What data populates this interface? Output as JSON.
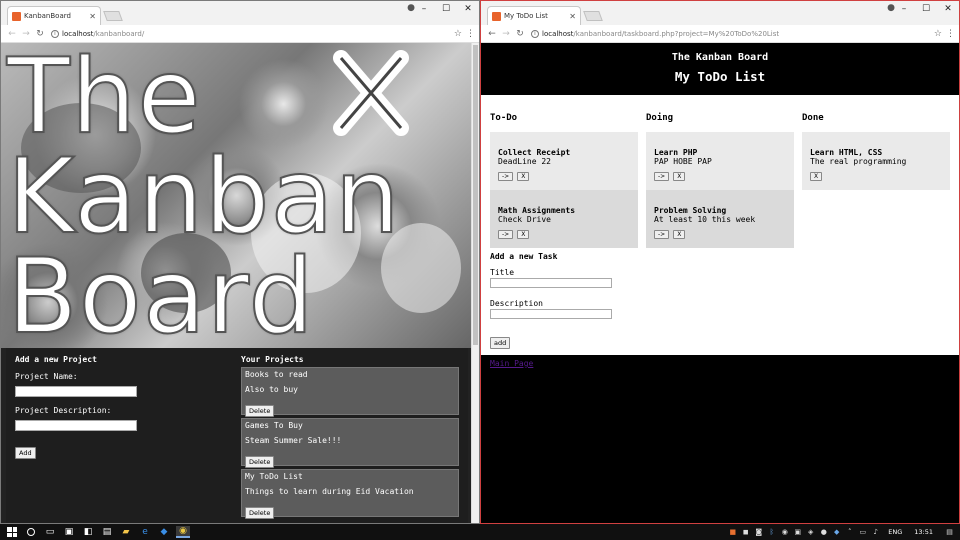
{
  "left_window": {
    "tab_title": "KanbanBoard",
    "url_host": "localhost",
    "url_path": "/kanbanboard/",
    "hero_title_line1": "The",
    "hero_title_line2": "Kanban",
    "hero_title_line3": "Board",
    "add_project": {
      "heading": "Add a new Project",
      "name_label": "Project Name:",
      "desc_label": "Project Description:",
      "add_button": "Add"
    },
    "your_projects": {
      "heading": "Your Projects",
      "items": [
        {
          "title": "Books to read",
          "description": "Also to buy",
          "delete": "Delete"
        },
        {
          "title": "Games To Buy",
          "description": "Steam Summer Sale!!!",
          "delete": "Delete"
        },
        {
          "title": "My ToDo List",
          "description": "Things to learn during Eid Vacation",
          "delete": "Delete"
        }
      ]
    }
  },
  "right_window": {
    "tab_title": "My ToDo List",
    "url_host": "localhost",
    "url_path": "/kanbanboard/taskboard.php?project=My%20ToDo%20List",
    "header_title": "The Kanban Board",
    "header_subtitle": "My ToDo List",
    "columns": [
      {
        "title": "To-Do",
        "tasks": [
          {
            "title": "Collect Receipt",
            "description": "DeadLine 22",
            "move": "->",
            "remove": "X"
          },
          {
            "title": "Math Assignments",
            "description": "Check Drive",
            "move": "->",
            "remove": "X"
          }
        ]
      },
      {
        "title": "Doing",
        "tasks": [
          {
            "title": "Learn PHP",
            "description": "PAP HOBE PAP",
            "move": "->",
            "remove": "X"
          },
          {
            "title": "Problem Solving",
            "description": "At least 10 this week",
            "move": "->",
            "remove": "X"
          }
        ]
      },
      {
        "title": "Done",
        "tasks": [
          {
            "title": "Learn HTML, CSS",
            "description": "The real programming",
            "remove": "X"
          }
        ]
      }
    ],
    "add_task": {
      "heading": "Add a new Task",
      "title_label": "Title",
      "desc_label": "Description",
      "add_button": "add"
    },
    "main_page_link": "Main Page"
  },
  "taskbar": {
    "language": "ENG",
    "clock": "13:51"
  },
  "colors": {
    "panel_dark": "#1e1e1e",
    "project_card": "#5c5c5c",
    "task_card": "#eaeaea",
    "favicon": "#e8632b",
    "link": "#551a8b"
  }
}
